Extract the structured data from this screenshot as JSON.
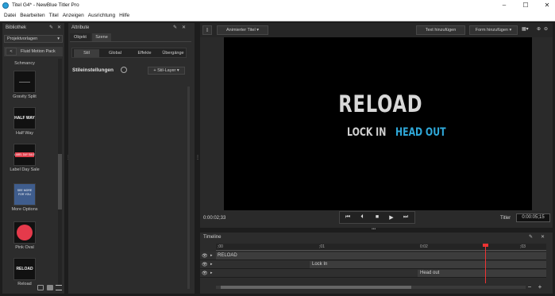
{
  "window": {
    "title": "Titel G4* - NewBlue Titler Pro",
    "min": "–",
    "max": "☐",
    "close": "✕"
  },
  "menu": [
    "Datei",
    "Bearbeiten",
    "Titel",
    "Anzeigen",
    "Ausrichtung",
    "Hilfe"
  ],
  "library": {
    "title": "Bibliothek",
    "dropdown": "Projektvorlagen",
    "pack": "Fluid Motion Pack",
    "back": "<",
    "items": [
      {
        "label": "Schmancy"
      },
      {
        "label": "Gravity Split"
      },
      {
        "label": "Half Way",
        "thumb_text": "HALF WAY"
      },
      {
        "label": "Label Day Sale",
        "thumb_text": "LABEL DAY SALE"
      },
      {
        "label": "More Options",
        "thumb_text": "SEE MORE FOR YOU"
      },
      {
        "label": "Pink Oval"
      },
      {
        "label": "Reload",
        "thumb_text": "RELOAD"
      }
    ]
  },
  "attributes": {
    "title": "Attribute",
    "tabs": [
      "Objekt",
      "Szene"
    ],
    "subtabs": [
      "Stil",
      "Global",
      "Effekte",
      "Übergänge"
    ],
    "style_settings": "Stileinstellungen",
    "style_layer": "+ Stil-Layer"
  },
  "toolbar": {
    "anim_title": "Animierter Titel",
    "add_text": "Text hinzufügen",
    "add_shape": "Form hinzufügen"
  },
  "preview": {
    "line1": "RELOAD",
    "line2a": "LOCK IN",
    "line2b": "HEAD OUT",
    "colors": {
      "line1": "#d8d8d8",
      "line2a": "#d0d0d0",
      "line2b": "#2fa8d9"
    }
  },
  "transport": {
    "current_time": "0:00:02;33",
    "titler_label": "Titler",
    "duration": "0:00:05;15"
  },
  "timeline": {
    "title": "Timeline",
    "ticks": [
      ";00",
      ";01",
      "0:02",
      ";03"
    ],
    "tracks": [
      "RELOAD",
      "Lock In",
      "Head out"
    ],
    "zoom_out": "−",
    "zoom_in": "+"
  }
}
